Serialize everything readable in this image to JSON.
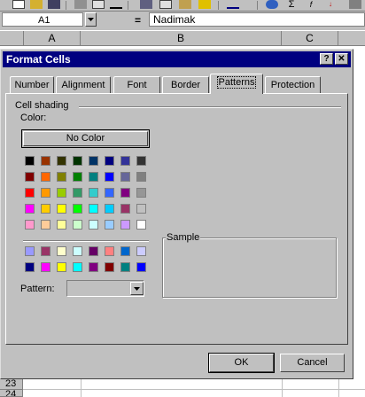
{
  "formula_bar": {
    "name_box": "A1",
    "equals": "=",
    "value": "Nadimak"
  },
  "columns": [
    "A",
    "B",
    "C"
  ],
  "rows": [
    "23",
    "24"
  ],
  "dialog": {
    "title": "Format Cells",
    "help_label": "?",
    "close_label": "✕",
    "tabs": [
      "Number",
      "Alignment",
      "Font",
      "Border",
      "Patterns",
      "Protection"
    ],
    "active_tab": "Patterns",
    "group_label": "Cell shading",
    "color_label": "Color:",
    "no_color_label": "No Color",
    "sample_label": "Sample",
    "pattern_label": "Pattern:",
    "pattern_value": "",
    "ok_label": "OK",
    "cancel_label": "Cancel"
  },
  "palette_main": [
    [
      "#000000",
      "#993300",
      "#333300",
      "#003300",
      "#003366",
      "#000080",
      "#333399",
      "#333333"
    ],
    [
      "#800000",
      "#ff6600",
      "#808000",
      "#008000",
      "#008080",
      "#0000ff",
      "#666699",
      "#808080"
    ],
    [
      "#ff0000",
      "#ff9900",
      "#99cc00",
      "#339966",
      "#33cccc",
      "#3366ff",
      "#800080",
      "#969696"
    ],
    [
      "#ff00ff",
      "#ffcc00",
      "#ffff00",
      "#00ff00",
      "#00ffff",
      "#00ccff",
      "#993366",
      "#c0c0c0"
    ],
    [
      "#ff99cc",
      "#ffcc99",
      "#ffff99",
      "#ccffcc",
      "#ccffff",
      "#99ccff",
      "#cc99ff",
      "#ffffff"
    ]
  ],
  "palette_extra": [
    [
      "#9999ff",
      "#993366",
      "#ffffcc",
      "#ccffff",
      "#660066",
      "#ff8080",
      "#0066cc",
      "#ccccff"
    ],
    [
      "#000080",
      "#ff00ff",
      "#ffff00",
      "#00ffff",
      "#800080",
      "#800000",
      "#008080",
      "#0000ff"
    ]
  ]
}
